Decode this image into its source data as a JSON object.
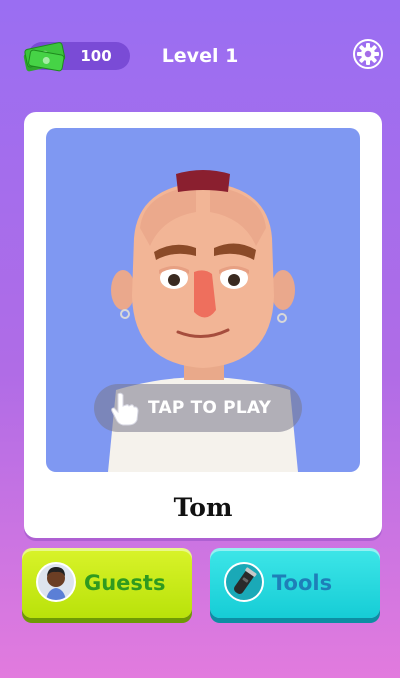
{
  "header": {
    "cash_icon": "money-stack-icon",
    "cash_value": "100",
    "level_title": "Level 1",
    "settings_icon": "gear-icon"
  },
  "card": {
    "tap_icon": "pointing-hand-icon",
    "tap_label": "TAP TO PLAY",
    "guest_name": "Tom"
  },
  "buttons": {
    "guests": {
      "label": "Guests",
      "icon": "guest-avatar-icon"
    },
    "tools": {
      "label": "Tools",
      "icon": "hair-clipper-icon"
    }
  },
  "colors": {
    "guests_button": "#c6ea14",
    "tools_button": "#2adbe0",
    "portrait_background": "#7f98f2"
  }
}
